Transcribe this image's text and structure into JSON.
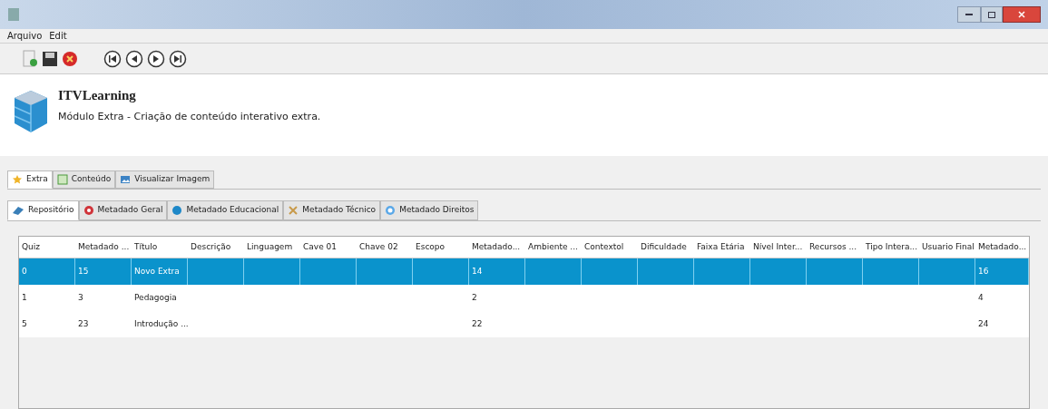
{
  "menu": [
    "Arquivo",
    "Edit"
  ],
  "header": {
    "title": "ITVLearning",
    "subtitle": "Módulo Extra - Criação de conteúdo interativo extra."
  },
  "tabs": [
    {
      "label": "Extra",
      "selected": true
    },
    {
      "label": "Conteúdo",
      "selected": false
    },
    {
      "label": "Visualizar Imagem",
      "selected": false
    }
  ],
  "subtabs": [
    {
      "label": "Repositório",
      "selected": true
    },
    {
      "label": "Metadado Geral",
      "selected": false
    },
    {
      "label": "Metadado Educacional",
      "selected": false
    },
    {
      "label": "Metadado Técnico",
      "selected": false
    },
    {
      "label": "Metadado Direitos",
      "selected": false
    }
  ],
  "table": {
    "columns": [
      "Quiz",
      "Metadado ...",
      "Título",
      "Descrição",
      "Linguagem",
      "Cave 01",
      "Chave 02",
      "Escopo",
      "Metadado...",
      "Ambiente ...",
      "Contextol",
      "Dificuldade",
      "Faixa Etária",
      "Nível Inter...",
      "Recursos ...",
      "Tipo Intera...",
      "Usuario Final",
      "Metadado..."
    ],
    "rows": [
      {
        "selected": true,
        "cells": [
          "0",
          "15",
          "Novo Extra",
          "",
          "",
          "",
          "",
          "",
          "14",
          "",
          "",
          "",
          "",
          "",
          "",
          "",
          "",
          "16"
        ]
      },
      {
        "selected": false,
        "cells": [
          "1",
          "3",
          "Pedagogia",
          "",
          "",
          "",
          "",
          "",
          "2",
          "",
          "",
          "",
          "",
          "",
          "",
          "",
          "",
          "4"
        ]
      },
      {
        "selected": false,
        "cells": [
          "5",
          "23",
          "Introdução ...",
          "",
          "",
          "",
          "",
          "",
          "22",
          "",
          "",
          "",
          "",
          "",
          "",
          "",
          "",
          "24"
        ]
      }
    ]
  }
}
